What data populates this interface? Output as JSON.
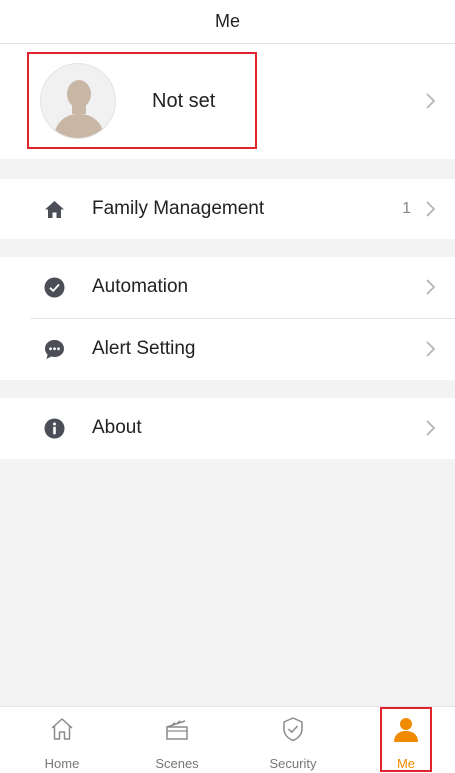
{
  "header": {
    "title": "Me"
  },
  "profile": {
    "name": "Not set"
  },
  "menu": {
    "family": {
      "label": "Family Management",
      "count": "1"
    },
    "automation": {
      "label": "Automation"
    },
    "alert": {
      "label": "Alert Setting"
    },
    "about": {
      "label": "About"
    }
  },
  "tabbar": {
    "items": [
      {
        "label": "Home",
        "icon": "home-icon"
      },
      {
        "label": "Scenes",
        "icon": "clapperboard-icon"
      },
      {
        "label": "Security",
        "icon": "shield-check-icon"
      },
      {
        "label": "Me",
        "icon": "person-icon",
        "active": true
      }
    ]
  },
  "colors": {
    "accent": "#f08a00",
    "highlight": "#e0232c",
    "icon": "#4b4e57"
  }
}
